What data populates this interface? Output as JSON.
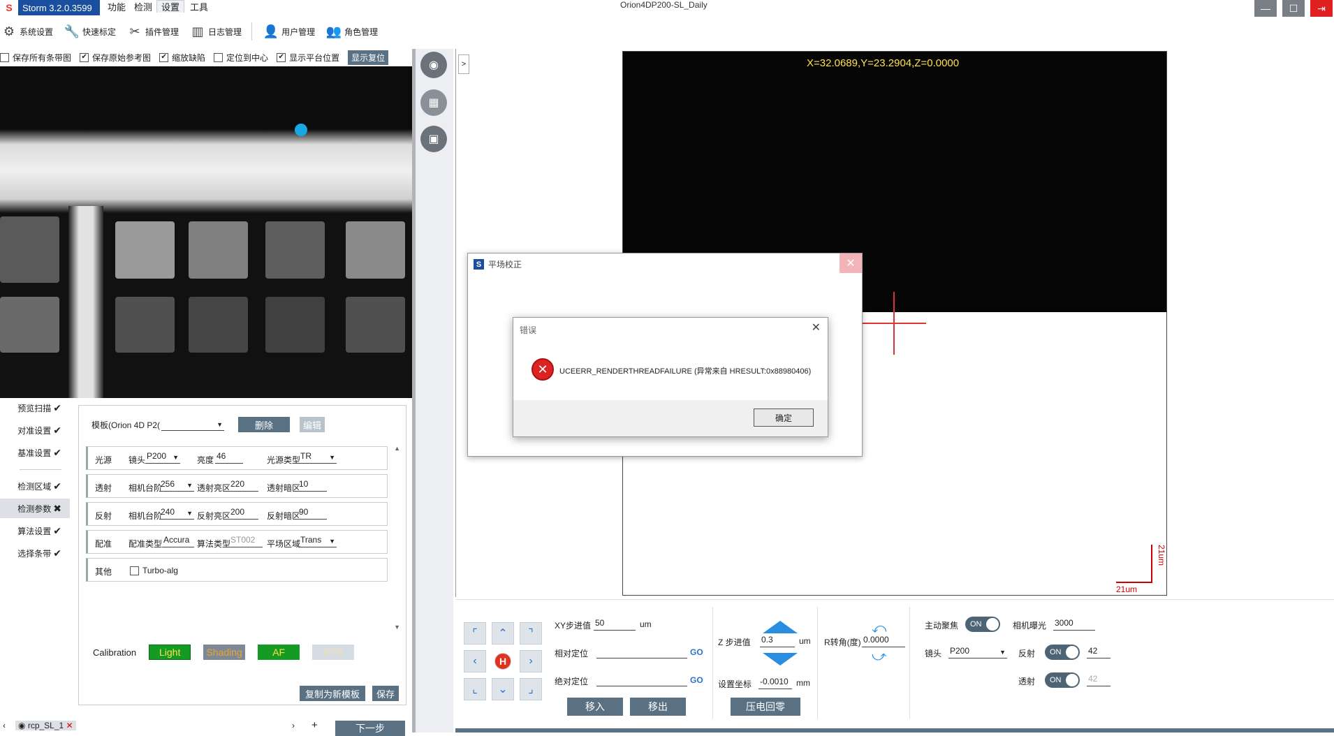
{
  "app": {
    "brand": "Storm 3.2.0.3599",
    "window_title": "Orion4DP200-SL_Daily"
  },
  "menu": [
    "功能",
    "检测",
    "设置",
    "工具"
  ],
  "window_controls": {
    "minimize": "—",
    "maximize": "☐",
    "exit": "⇥"
  },
  "toolbar": [
    {
      "label": "系统设置",
      "icon": "gear-icon"
    },
    {
      "label": "快速标定",
      "icon": "wrench-icon"
    },
    {
      "label": "插件管理",
      "icon": "tools-icon"
    },
    {
      "label": "日志管理",
      "icon": "log-icon"
    },
    {
      "label": "用户管理",
      "icon": "user-icon"
    },
    {
      "label": "角色管理",
      "icon": "role-icon"
    }
  ],
  "options": [
    {
      "label": "保存所有条带图",
      "checked": false
    },
    {
      "label": "保存原始参考图",
      "checked": true
    },
    {
      "label": "缩放缺陷",
      "checked": true
    },
    {
      "label": "定位到中心",
      "checked": false
    },
    {
      "label": "显示平台位置",
      "checked": true
    }
  ],
  "show_reset": "显示复位",
  "steps": [
    {
      "label": "预览扫描",
      "mark": "✔"
    },
    {
      "label": "对准设置",
      "mark": "✔"
    },
    {
      "label": "基准设置",
      "mark": "✔"
    },
    {
      "label": "检测区域",
      "mark": "✔"
    },
    {
      "label": "检测参数",
      "mark": "✖"
    },
    {
      "label": "算法设置",
      "mark": "✔"
    },
    {
      "label": "选择条带",
      "mark": "✔"
    }
  ],
  "template": {
    "label": "模板(Orion 4D P2(",
    "delete": "删除",
    "edit": "编辑"
  },
  "params": {
    "light": {
      "name": "光源",
      "lens_label": "镜头",
      "lens": "P200",
      "brightness_label": "亮度",
      "brightness": "46",
      "type_label": "光源类型",
      "type": "TR"
    },
    "trans": {
      "name": "透射",
      "step_label": "相机台阶",
      "step": "256",
      "bright_label": "透射亮区",
      "bright": "220",
      "dark_label": "透射暗区",
      "dark": "10"
    },
    "refl": {
      "name": "反射",
      "step_label": "相机台阶",
      "step": "240",
      "bright_label": "反射亮区",
      "bright": "200",
      "dark_label": "反射暗区",
      "dark": "90"
    },
    "align": {
      "name": "配准",
      "type_label": "配准类型",
      "type": "Accura",
      "alg_label": "算法类型",
      "alg": "ST002",
      "area_label": "平场区域",
      "area": "Trans"
    },
    "other": {
      "name": "其他",
      "turbo": "Turbo-alg"
    }
  },
  "calibration": {
    "label": "Calibration",
    "light": "Light",
    "shading": "Shading",
    "af": "AF",
    "rtb": "RTB"
  },
  "save_as_new": "复制为新模板",
  "save": "保存",
  "tab": {
    "name": "rcp_SL_1",
    "next": "下一步"
  },
  "view": {
    "coords": "X=32.0689,Y=23.2904,Z=0.0000",
    "scale": "21um",
    "expand": ">"
  },
  "stage": {
    "xy_step_label": "XY步进值",
    "xy_step": "50",
    "xy_unit": "um",
    "rel_label": "相对定位",
    "abs_label": "绝对定位",
    "go": "GO",
    "move_in": "移入",
    "move_out": "移出",
    "z_step_label": "Z 步进值",
    "z_step": "0.3",
    "z_unit": "um",
    "set_coord_label": "设置坐标",
    "set_coord": "-0.0010",
    "set_unit": "mm",
    "piezo_zero": "压电回零",
    "r_label": "R转角(度)",
    "r_value": "0.0000",
    "af_label": "主动聚焦",
    "exposure_label": "相机曝光",
    "exposure": "3000",
    "lens_label": "镜头",
    "lens": "P200",
    "refl_label": "反射",
    "refl_value": "42",
    "trans_label": "透射",
    "trans_value": "42",
    "on": "ON"
  },
  "dialog_outer": {
    "title": "平场校正",
    "close": "✕"
  },
  "dialog_error": {
    "title": "错误",
    "close": "✕",
    "message": "UCEERR_RENDERTHREADFAILURE (异常来自 HRESULT:0x88980406)",
    "ok": "确定"
  }
}
